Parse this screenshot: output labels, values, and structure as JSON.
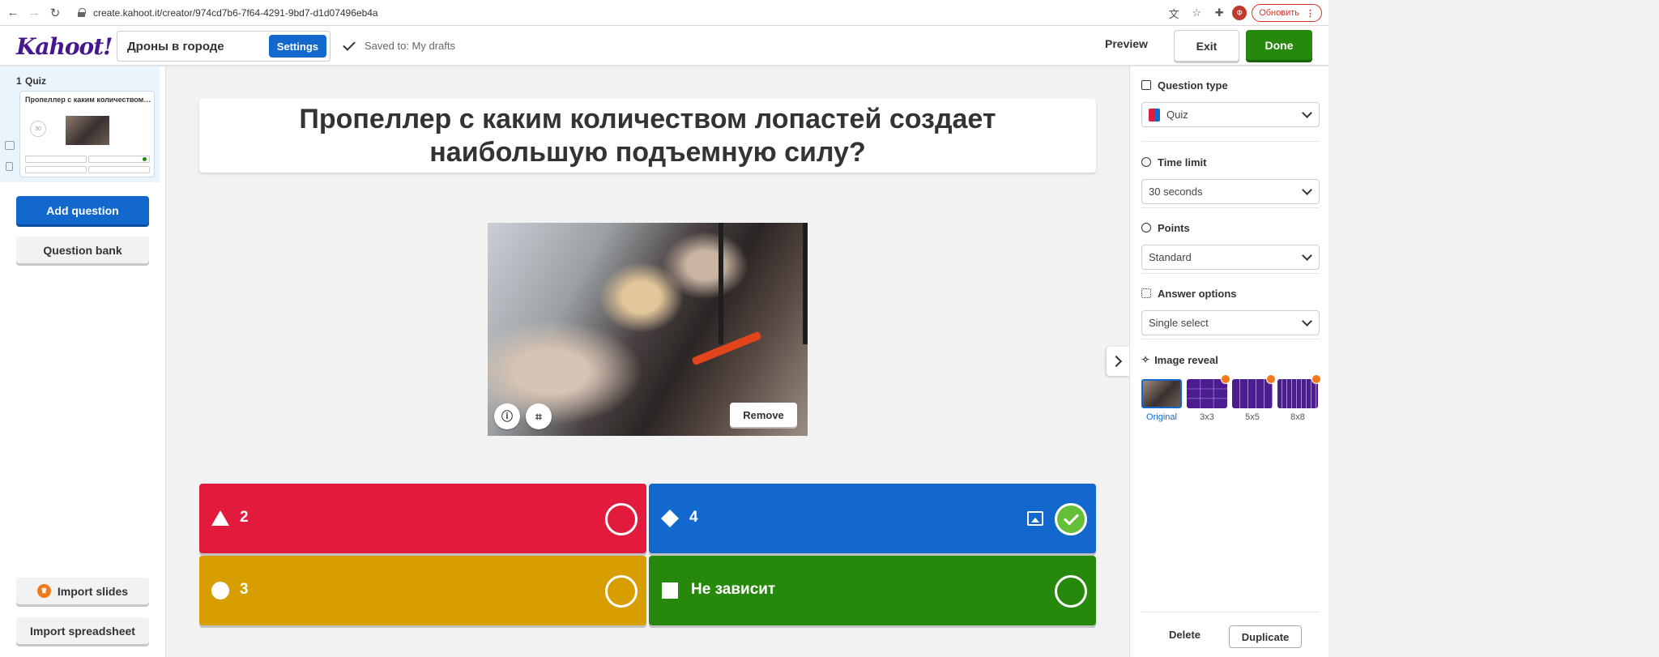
{
  "browser": {
    "url": "create.kahoot.it/creator/974cd7b6-7f64-4291-9bd7-d1d07496eb4a",
    "update_label": "Обновить",
    "avatar_letter": "Ф"
  },
  "topbar": {
    "logo": "Kahoot!",
    "kahoot_title": "Дроны в городе",
    "settings_label": "Settings",
    "saved_text": "Saved to: My drafts",
    "preview_label": "Preview",
    "exit_label": "Exit",
    "done_label": "Done"
  },
  "sidebar": {
    "slide_number": "1",
    "slide_type": "Quiz",
    "slide_preview_title": "Пропеллер с каким количеством лопастей создает наибольшую подъемную силу?",
    "slide_timer": "30",
    "add_question_label": "Add question",
    "question_bank_label": "Question bank",
    "import_slides_label": "Import slides",
    "import_spreadsheet_label": "Import spreadsheet"
  },
  "question": {
    "text": "Пропеллер с каким количеством лопастей создает наибольшую подъемную силу?",
    "remove_label": "Remove",
    "answers": [
      {
        "text": "2",
        "color": "#e21b3c",
        "shape": "triangle",
        "correct": false
      },
      {
        "text": "4",
        "color": "#1368ce",
        "shape": "diamond",
        "correct": true
      },
      {
        "text": "3",
        "color": "#d89e00",
        "shape": "circle",
        "correct": false
      },
      {
        "text": "Не зависит",
        "color": "#26890c",
        "shape": "square",
        "correct": false
      }
    ]
  },
  "settings_panel": {
    "question_type_label": "Question type",
    "question_type_value": "Quiz",
    "time_limit_label": "Time limit",
    "time_limit_value": "30 seconds",
    "points_label": "Points",
    "points_value": "Standard",
    "answer_options_label": "Answer options",
    "answer_options_value": "Single select",
    "image_reveal_label": "Image reveal",
    "reveal_options": [
      "Original",
      "3x3",
      "5x5",
      "8x8"
    ],
    "delete_label": "Delete",
    "duplicate_label": "Duplicate"
  }
}
